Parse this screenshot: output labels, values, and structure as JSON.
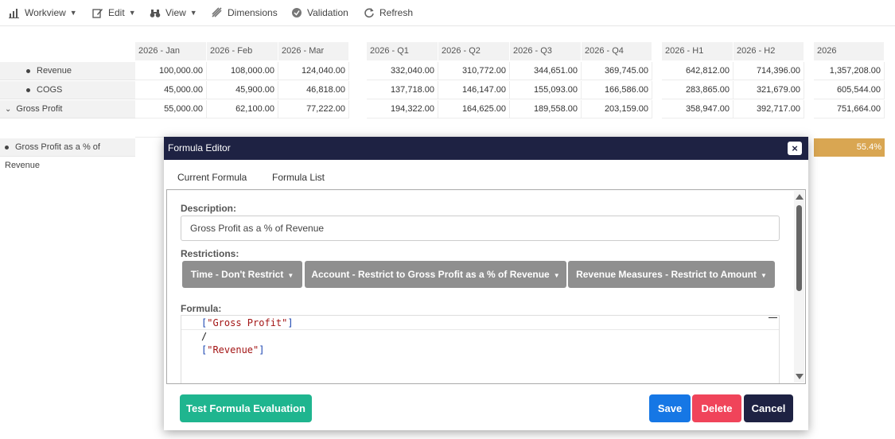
{
  "toolbar": {
    "workview": "Workview",
    "edit": "Edit",
    "view": "View",
    "dimensions": "Dimensions",
    "validation": "Validation",
    "refresh": "Refresh"
  },
  "grid": {
    "group1_headers": [
      "2026 - Jan",
      "2026 - Feb",
      "2026 - Mar"
    ],
    "group2_headers": [
      "2026 - Q1",
      "2026 - Q2",
      "2026 - Q3",
      "2026 - Q4"
    ],
    "group3_headers": [
      "2026 - H1",
      "2026 - H2"
    ],
    "group4_headers": [
      "2026"
    ],
    "rows": [
      {
        "label": "Revenue",
        "g1": [
          "100,000.00",
          "108,000.00",
          "124,040.00"
        ],
        "g2": [
          "332,040.00",
          "310,772.00",
          "344,651.00",
          "369,745.00"
        ],
        "g3": [
          "642,812.00",
          "714,396.00"
        ],
        "g4": [
          "1,357,208.00"
        ]
      },
      {
        "label": "COGS",
        "g1": [
          "45,000.00",
          "45,900.00",
          "46,818.00"
        ],
        "g2": [
          "137,718.00",
          "146,147.00",
          "155,093.00",
          "166,586.00"
        ],
        "g3": [
          "283,865.00",
          "321,679.00"
        ],
        "g4": [
          "605,544.00"
        ]
      },
      {
        "label": "Gross Profit",
        "g1": [
          "55,000.00",
          "62,100.00",
          "77,222.00"
        ],
        "g2": [
          "194,322.00",
          "164,625.00",
          "189,558.00",
          "203,159.00"
        ],
        "g3": [
          "358,947.00",
          "392,717.00"
        ],
        "g4": [
          "751,664.00"
        ]
      }
    ],
    "pct_row": {
      "label": "Gross Profit as a % of Revenue",
      "total": "55.4%"
    },
    "highlight_color": "#d9a652"
  },
  "modal": {
    "title": "Formula Editor",
    "close": "×",
    "tabs": [
      "Current Formula",
      "Formula List"
    ],
    "description_label": "Description:",
    "description_value": "Gross Profit as a % of Revenue",
    "restrictions_label": "Restrictions:",
    "restrictions": [
      "Time - Don't Restrict",
      "Account - Restrict to Gross Profit as a % of Revenue",
      "Revenue Measures - Restrict to Amount"
    ],
    "formula_label": "Formula:",
    "formula": {
      "line1_open": "[",
      "line1_str": "\"Gross Profit\"",
      "line1_close": "]",
      "line2": "/",
      "line3_open": "[",
      "line3_str": "\"Revenue\"",
      "line3_close": "]"
    },
    "buttons": {
      "test": "Test Formula Evaluation",
      "save": "Save",
      "delete": "Delete",
      "cancel": "Cancel"
    },
    "colors": {
      "title_bar": "#1e2243",
      "test": "#1fb58f",
      "save": "#1677e5",
      "delete": "#f0445a",
      "cancel": "#1e2243",
      "restrict_btn": "#8f8f8f"
    }
  }
}
